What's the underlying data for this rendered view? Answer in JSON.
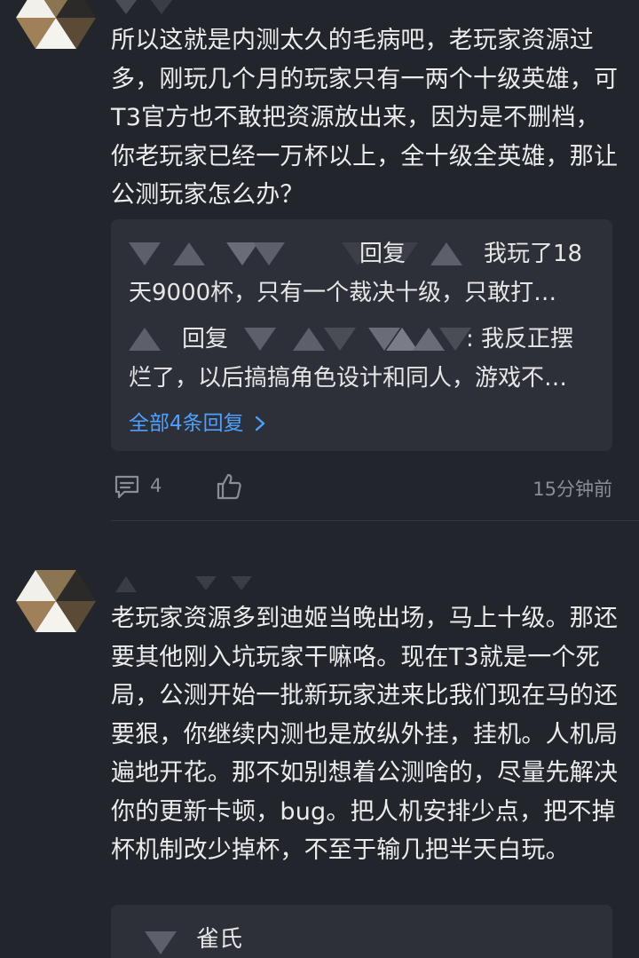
{
  "comment1": {
    "text": "所以这就是内测太久的毛病吧，老玩家资源过多，刚玩几个月的玩家只有一两个十级英雄，可T3官方也不敢把资源放出来，因为是不删档，你老玩家已经一万杯以上，全十级全英雄，那让公测玩家怎么办？",
    "replies": [
      {
        "reply_word": "回复",
        "text_line1": "我玩了18",
        "text_line2": "天9000杯，只有一个裁决十级，只敢打…"
      },
      {
        "reply_word": "回复",
        "text_line1": ": 我反正摆",
        "text_line2": "烂了，以后搞搞角色设计和同人，游戏不…"
      }
    ],
    "more_replies": "全部4条回复",
    "comment_count": "4",
    "time": "15分钟前"
  },
  "comment2": {
    "text": "老玩家资源多到迪姬当晚出场，马上十级。那还要其他刚入坑玩家干嘛咯。现在T3就是一个死局，公测开始一批新玩家进来比我们现在马的还要狠，你继续内测也是放纵外挂，挂机。人机局遍地开花。那不如别想着公测啥的，尽量先解决你的更新卡顿，bug。把人机安排少点，把不掉杯机制改少掉杯，不至于输几把半天白玩。",
    "reply_preview_name": "雀氏"
  },
  "icons": {
    "comment": "comment-bubble-icon",
    "like": "thumbs-up-icon",
    "chevron": "chevron-right-icon"
  },
  "colors": {
    "background": "#23252d",
    "reply_box": "#2d3039",
    "link": "#4ea0ff",
    "muted": "#8a8d96"
  }
}
